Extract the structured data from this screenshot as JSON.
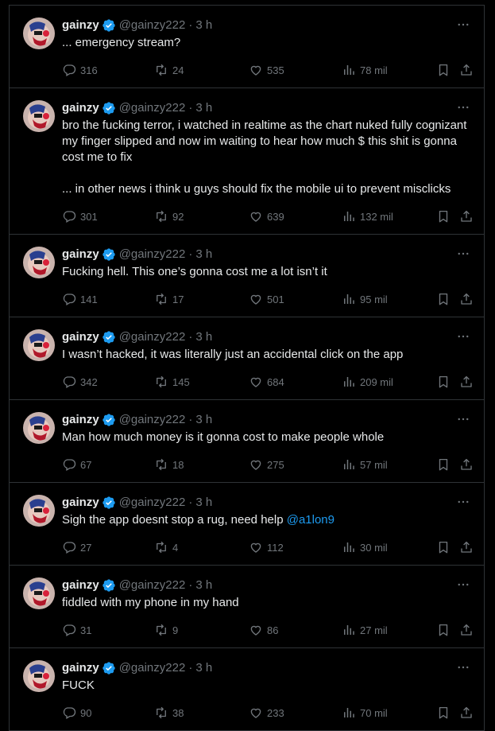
{
  "tweets": [
    {
      "name": "gainzy",
      "handle": "@gainzy222",
      "time": "3 h",
      "text": "... emergency stream?",
      "mention": "",
      "replies": "316",
      "retweets": "24",
      "likes": "535",
      "views": "78 mil"
    },
    {
      "name": "gainzy",
      "handle": "@gainzy222",
      "time": "3 h",
      "text": "bro the fucking terror, i watched in realtime as the chart nuked fully cognizant my finger slipped and now im waiting to hear how much $ this shit is gonna cost me to fix\n\n... in other news i think u guys should fix the mobile ui to prevent misclicks",
      "mention": "",
      "replies": "301",
      "retweets": "92",
      "likes": "639",
      "views": "132 mil"
    },
    {
      "name": "gainzy",
      "handle": "@gainzy222",
      "time": "3 h",
      "text": "Fucking hell. This one’s gonna cost me a lot isn’t it",
      "mention": "",
      "replies": "141",
      "retweets": "17",
      "likes": "501",
      "views": "95 mil"
    },
    {
      "name": "gainzy",
      "handle": "@gainzy222",
      "time": "3 h",
      "text": "I wasn’t hacked, it was literally just an accidental click on the app",
      "mention": "",
      "replies": "342",
      "retweets": "145",
      "likes": "684",
      "views": "209 mil"
    },
    {
      "name": "gainzy",
      "handle": "@gainzy222",
      "time": "3 h",
      "text": "Man how much money is it gonna cost to make people whole",
      "mention": "",
      "replies": "67",
      "retweets": "18",
      "likes": "275",
      "views": "57 mil"
    },
    {
      "name": "gainzy",
      "handle": "@gainzy222",
      "time": "3 h",
      "text": "Sigh the app doesnt stop a rug, need help ",
      "mention": "@a1lon9",
      "replies": "27",
      "retweets": "4",
      "likes": "112",
      "views": "30 mil"
    },
    {
      "name": "gainzy",
      "handle": "@gainzy222",
      "time": "3 h",
      "text": "fiddled with my phone in my hand",
      "mention": "",
      "replies": "31",
      "retweets": "9",
      "likes": "86",
      "views": "27 mil"
    },
    {
      "name": "gainzy",
      "handle": "@gainzy222",
      "time": "3 h",
      "text": "FUCK",
      "mention": "",
      "replies": "90",
      "retweets": "38",
      "likes": "233",
      "views": "70 mil"
    }
  ],
  "colors": {
    "background": "#000000",
    "text": "#e7e9ea",
    "muted": "#71767b",
    "border": "#2f3336",
    "accent": "#1d9bf0"
  },
  "icons": {
    "verified": "verified-badge-icon",
    "more": "more-options-icon",
    "reply": "reply-icon",
    "retweet": "retweet-icon",
    "like": "heart-icon",
    "views": "views-chart-icon",
    "bookmark": "bookmark-icon",
    "share": "share-icon"
  }
}
